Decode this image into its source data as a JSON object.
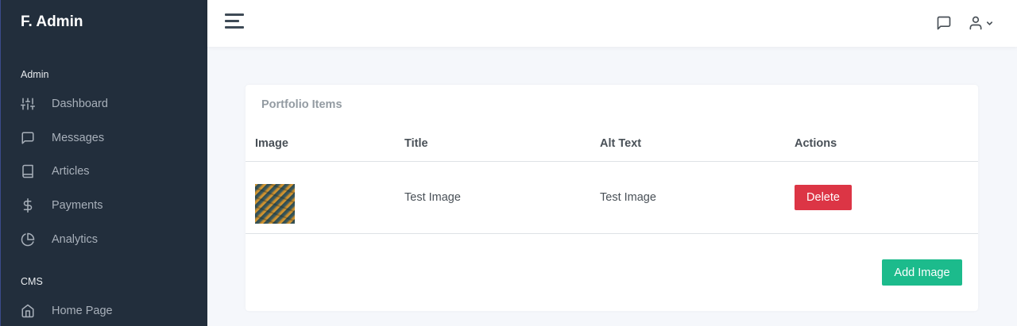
{
  "brand": "F. Admin",
  "sidebar": {
    "sections": [
      {
        "header": "Admin"
      },
      {
        "header": "CMS"
      }
    ],
    "items": [
      {
        "label": "Dashboard",
        "icon": "sliders-icon"
      },
      {
        "label": "Messages",
        "icon": "message-square-icon"
      },
      {
        "label": "Articles",
        "icon": "book-icon"
      },
      {
        "label": "Payments",
        "icon": "dollar-sign-icon"
      },
      {
        "label": "Analytics",
        "icon": "pie-chart-icon"
      },
      {
        "label": "Home Page",
        "icon": "home-icon"
      }
    ]
  },
  "topbar": {
    "menu_icon": "hamburger-icon",
    "messages_icon": "message-square-icon",
    "user_icon": "user-icon",
    "dropdown_icon": "chevron-down-icon"
  },
  "card": {
    "title": "Portfolio Items",
    "columns": [
      "Image",
      "Title",
      "Alt Text",
      "Actions"
    ],
    "rows": [
      {
        "title": "Test Image",
        "alt_text": "Test Image",
        "action_label": "Delete"
      }
    ],
    "add_button": "Add Image"
  },
  "colors": {
    "sidebar_bg": "#222e3c",
    "danger": "#dc3545",
    "success": "#1cbb8c",
    "page_bg": "#f5f7fb"
  }
}
